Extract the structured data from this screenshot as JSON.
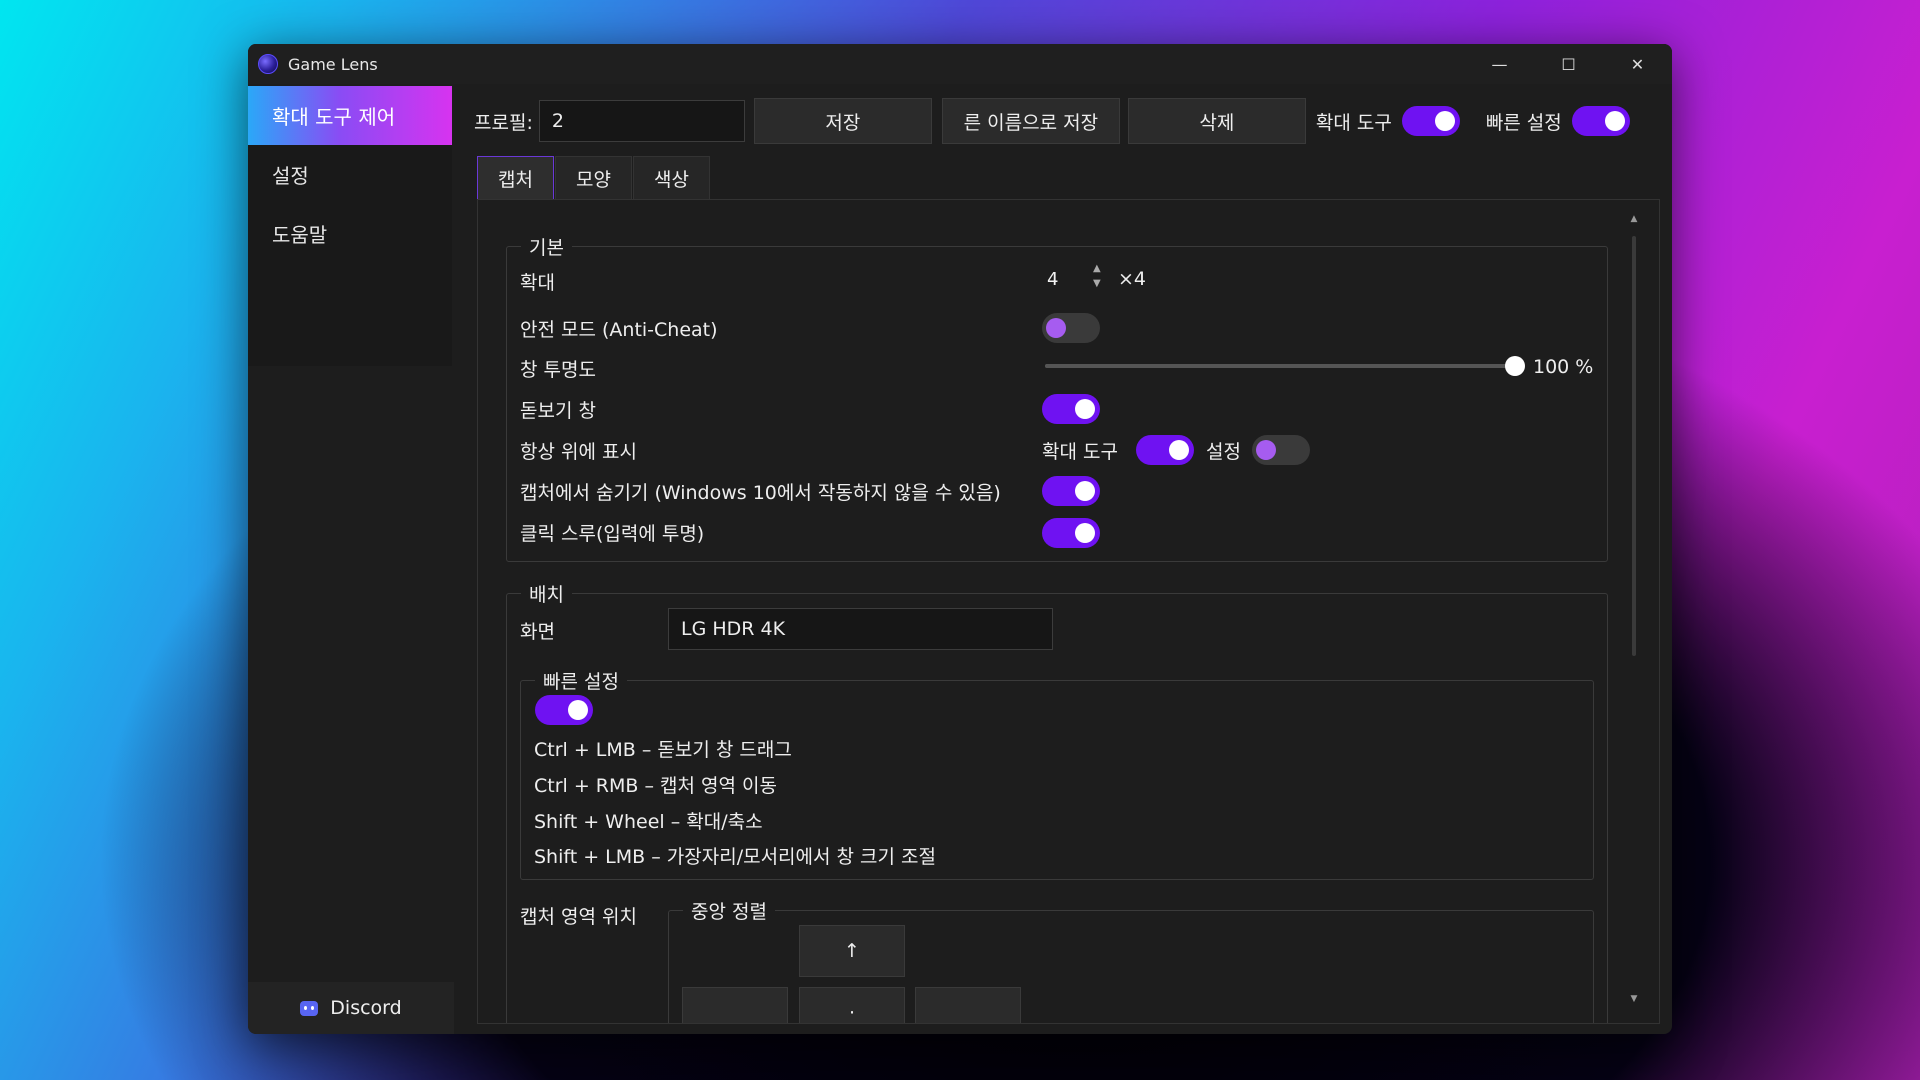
{
  "window": {
    "title": "Game Lens"
  },
  "sidebar": {
    "items": [
      {
        "label": "확대 도구 제어",
        "active": true
      },
      {
        "label": "설정",
        "active": false
      },
      {
        "label": "도움말",
        "active": false
      }
    ],
    "discord_label": "Discord"
  },
  "toolbar": {
    "profile_label": "프로필:",
    "profile_value": "2",
    "save_label": "저장",
    "save_as_label": "른 이름으로 저장",
    "delete_label": "삭제",
    "magnifier_label": "확대 도구",
    "magnifier_on": true,
    "quick_label": "빠른 설정",
    "quick_on": true
  },
  "tabs": [
    {
      "label": "캡처",
      "active": true
    },
    {
      "label": "모양",
      "active": false
    },
    {
      "label": "색상",
      "active": false
    }
  ],
  "basic": {
    "title": "기본",
    "zoom_label": "확대",
    "zoom_value": "4",
    "zoom_suffix": "×4",
    "safe_mode_label": "안전 모드 (Anti-Cheat)",
    "safe_mode_on": false,
    "opacity_label": "창 투명도",
    "opacity_value": "100 %",
    "opacity_fraction": 1.0,
    "lens_window_label": "돋보기 창",
    "lens_window_on": true,
    "always_on_top_label": "항상 위에 표시",
    "aot_magnifier_label": "확대 도구",
    "aot_magnifier_on": true,
    "aot_settings_label": "설정",
    "aot_settings_on": false,
    "hide_capture_label": "캡처에서 숨기기 (Windows 10에서 작동하지 않을 수 있음)",
    "hide_capture_on": true,
    "click_through_label": "클릭 스루(입력에 투명)",
    "click_through_on": true
  },
  "placement": {
    "title": "배치",
    "screen_label": "화면",
    "screen_value": "LG HDR 4K",
    "quick_settings": {
      "title": "빠른 설정",
      "enabled": true,
      "shortcuts": [
        "Ctrl + LMB – 돋보기 창 드래그",
        "Ctrl + RMB – 캡처 영역 이동",
        "Shift + Wheel – 확대/축소",
        "Shift + LMB – 가장자리/모서리에서 창 크기 조절"
      ]
    },
    "capture_pos_label": "캡처 영역 위치",
    "align_title": "중앙 정렬",
    "up_arrow": "↑",
    "center_glyph": "·"
  },
  "colors": {
    "accent": "#6f12f2",
    "window_bg": "#1d1d1d"
  }
}
